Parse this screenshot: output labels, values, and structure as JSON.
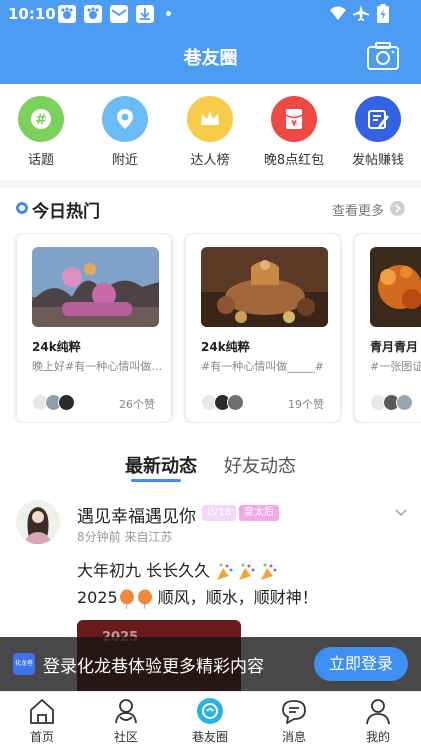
{
  "status_bar": {
    "time": "10:10"
  },
  "header": {
    "title": "巷友圈"
  },
  "quick_menu": [
    {
      "label": "话题",
      "icon": "hashtag-icon",
      "color": "#7bd15c"
    },
    {
      "label": "附近",
      "icon": "location-icon",
      "color": "#6bbcf6"
    },
    {
      "label": "达人榜",
      "icon": "crown-icon",
      "color": "#f7cc4a"
    },
    {
      "label": "晚8点红包",
      "icon": "red-envelope-icon",
      "color": "#ee4a43"
    },
    {
      "label": "发帖赚钱",
      "icon": "post-edit-icon",
      "color": "#3562e0"
    }
  ],
  "hot": {
    "title": "今日热门",
    "more": "查看更多",
    "cards": [
      {
        "title": "24k纯粹",
        "desc": "晚上好#有一种心情叫做…",
        "likes": "26个赞"
      },
      {
        "title": "24k纯粹",
        "desc": "#有一种心情叫做_____#",
        "likes": "19个赞"
      },
      {
        "title": "青月青月",
        "desc": "#一张图证明…",
        "likes": ""
      }
    ]
  },
  "tabs": {
    "active": "最新动态",
    "inactive": "好友动态"
  },
  "post": {
    "username": "遇见幸福遇见你",
    "level": "LV18",
    "role": "皇太后",
    "meta": "8分钟前 来自江苏",
    "line1": "大年初九 长长久久",
    "line2_year": "2025",
    "line2_text": "顺风，顺水，顺财神！",
    "image_text": "2025"
  },
  "login_banner": {
    "logo_text": "化龙巷",
    "text": "登录化龙巷体验更多精彩内容",
    "button": "立即登录"
  },
  "bottom_nav": [
    {
      "label": "首页",
      "icon": "home-icon"
    },
    {
      "label": "社区",
      "icon": "community-icon"
    },
    {
      "label": "巷友圈",
      "icon": "friends-circle-icon"
    },
    {
      "label": "消息",
      "icon": "message-icon"
    },
    {
      "label": "我的",
      "icon": "profile-icon"
    }
  ],
  "colors": {
    "brand_blue": "#4c9cf4",
    "accent_blue": "#3d8ff2"
  }
}
